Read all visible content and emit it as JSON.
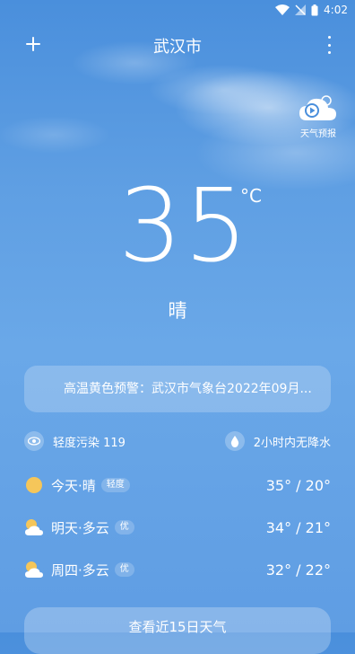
{
  "status_bar": {
    "time": "4:02"
  },
  "header": {
    "city": "武汉市"
  },
  "forecast_video": {
    "label": "天气预报"
  },
  "current": {
    "temperature": "35",
    "unit": "°C",
    "condition": "晴"
  },
  "alert": {
    "text": "高温黄色预警：武汉市气象台2022年09月..."
  },
  "info": {
    "air_quality": "轻度污染 119",
    "precipitation": "2小时内无降水"
  },
  "days": [
    {
      "label": "今天·晴",
      "badge": "轻度",
      "temp": "35° / 20°",
      "icon": "sun-icon"
    },
    {
      "label": "明天·多云",
      "badge": "优",
      "temp": "34° / 21°",
      "icon": "partly-cloudy-icon"
    },
    {
      "label": "周四·多云",
      "badge": "优",
      "temp": "32° / 22°",
      "icon": "partly-cloudy-icon"
    }
  ],
  "bottom_button": {
    "label": "查看近15日天气"
  },
  "colors": {
    "sky_top": "#4a8fdc",
    "sky_bottom": "#5f9de3",
    "sun": "#f5c65a"
  }
}
